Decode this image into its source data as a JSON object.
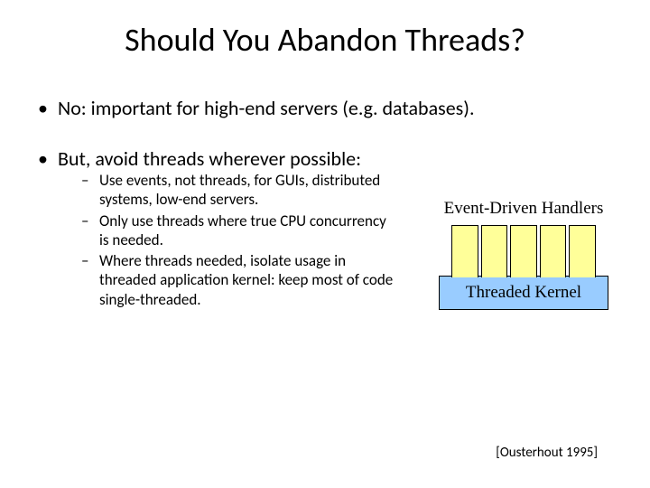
{
  "title": "Should You Abandon Threads?",
  "bullets": {
    "b1": "No: important for high-end servers (e.g. databases).",
    "b2": "But, avoid threads wherever possible:"
  },
  "sub": {
    "s1": "Use events, not threads, for GUIs, distributed systems, low-end servers.",
    "s2": "Only use threads where true CPU concurrency is needed.",
    "s3": "Where threads needed, isolate usage in threaded application kernel: keep most of code single-threaded."
  },
  "diagram": {
    "top_label": "Event-Driven Handlers",
    "kernel_label": "Threaded Kernel"
  },
  "citation": "[Ousterhout 1995]"
}
